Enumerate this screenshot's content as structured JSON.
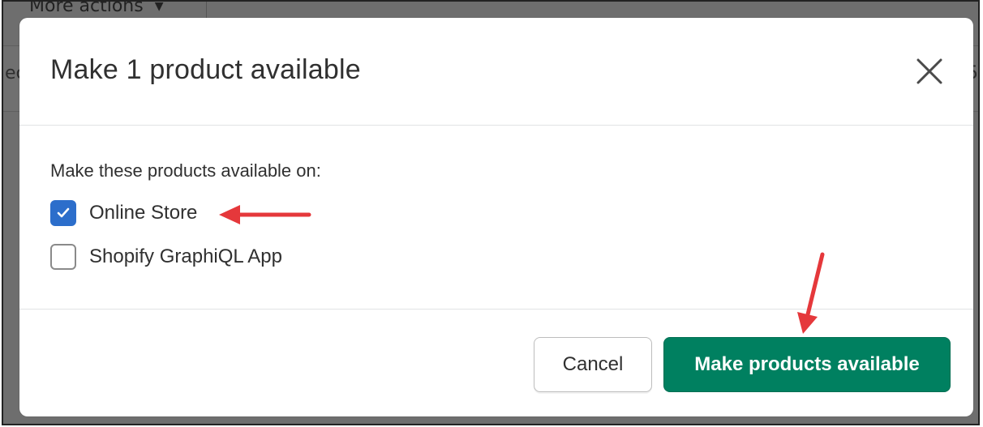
{
  "background": {
    "more_actions_label": "More actions",
    "left_edge_text": "ec",
    "right_edge_text": "25"
  },
  "modal": {
    "title": "Make 1 product available",
    "body_label": "Make these products available on:",
    "options": [
      {
        "label": "Online Store",
        "checked": true
      },
      {
        "label": "Shopify GraphiQL App",
        "checked": false
      }
    ],
    "cancel_label": "Cancel",
    "primary_label": "Make products available"
  },
  "colors": {
    "primary": "#008060",
    "checkbox_checked": "#2c6ecb",
    "annotation_arrow": "#e5383b"
  },
  "icons": {
    "close": "close-icon",
    "check": "checkmark-icon",
    "arrow": "arrow-annotation"
  }
}
